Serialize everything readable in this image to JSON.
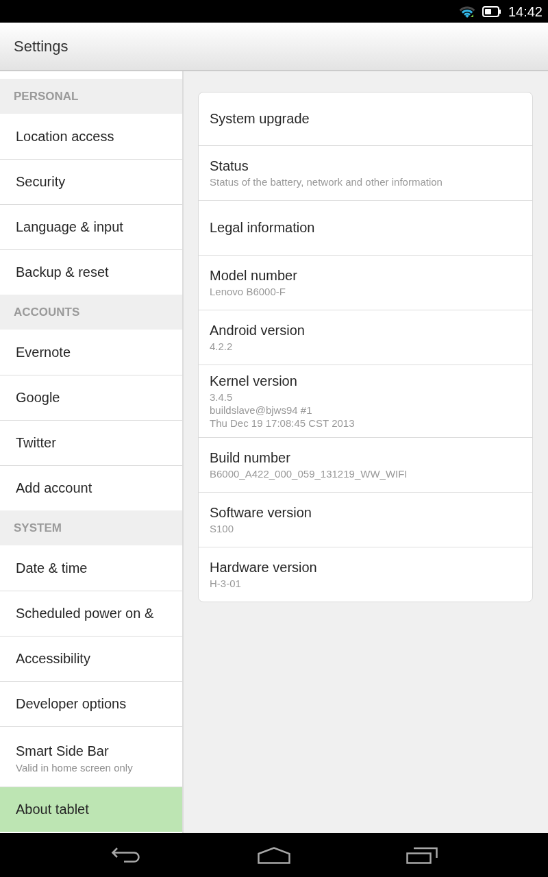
{
  "status_bar": {
    "time": "14:42"
  },
  "action_bar": {
    "title": "Settings"
  },
  "sidebar": {
    "sections": [
      {
        "header": "PERSONAL",
        "items": [
          {
            "label": "Location access",
            "selected": false
          },
          {
            "label": "Security",
            "selected": false
          },
          {
            "label": "Language & input",
            "selected": false
          },
          {
            "label": "Backup & reset",
            "selected": false
          }
        ]
      },
      {
        "header": "ACCOUNTS",
        "items": [
          {
            "label": "Evernote",
            "selected": false
          },
          {
            "label": "Google",
            "selected": false
          },
          {
            "label": "Twitter",
            "selected": false
          },
          {
            "label": "Add account",
            "selected": false
          }
        ]
      },
      {
        "header": "SYSTEM",
        "items": [
          {
            "label": "Date & time",
            "selected": false
          },
          {
            "label": "Scheduled power on &",
            "selected": false
          },
          {
            "label": "Accessibility",
            "selected": false
          },
          {
            "label": "Developer options",
            "selected": false
          },
          {
            "label": "Smart Side Bar",
            "summary": "Valid in home screen only",
            "selected": false
          },
          {
            "label": "About tablet",
            "selected": true
          }
        ]
      }
    ]
  },
  "about": {
    "items": [
      {
        "title": "System upgrade"
      },
      {
        "title": "Status",
        "summary": [
          "Status of the battery, network and other information"
        ]
      },
      {
        "title": "Legal information"
      },
      {
        "title": "Model number",
        "summary": [
          "Lenovo B6000-F"
        ]
      },
      {
        "title": "Android version",
        "summary": [
          "4.2.2"
        ]
      },
      {
        "title": "Kernel version",
        "summary": [
          "3.4.5",
          "buildslave@bjws94 #1",
          "Thu Dec 19 17:08:45 CST 2013"
        ]
      },
      {
        "title": "Build number",
        "summary": [
          "B6000_A422_000_059_131219_WW_WIFI"
        ]
      },
      {
        "title": "Software version",
        "summary": [
          "S100"
        ]
      },
      {
        "title": "Hardware version",
        "summary": [
          "H-3-01"
        ]
      }
    ]
  }
}
